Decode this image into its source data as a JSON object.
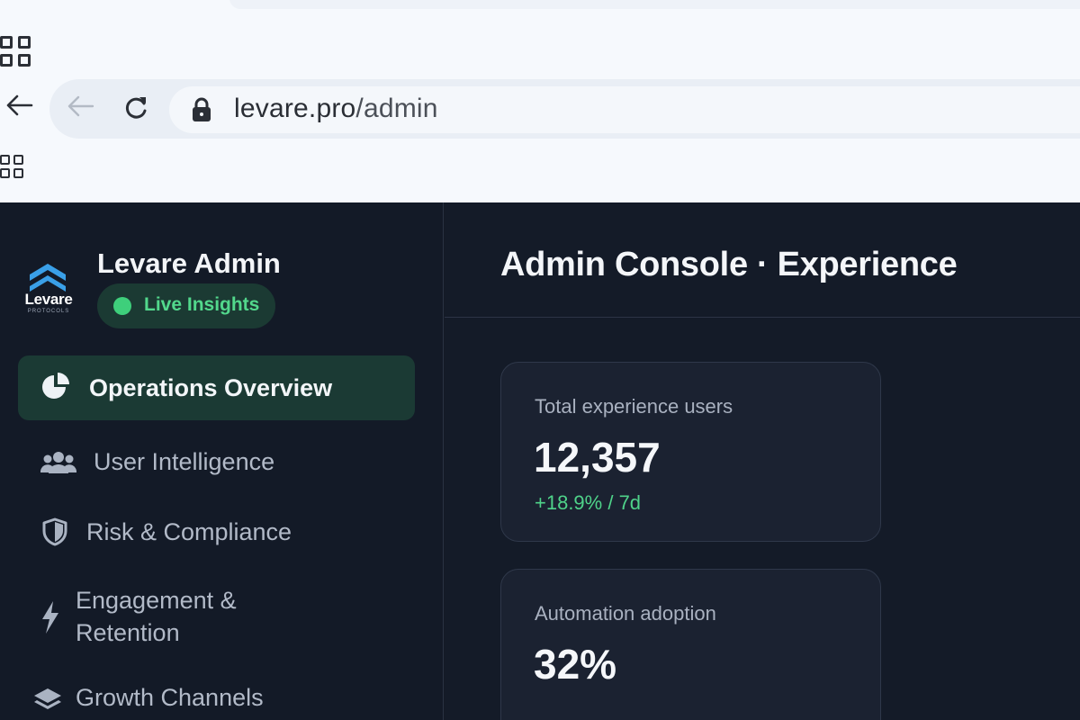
{
  "browser": {
    "url_host": "levare.pro",
    "url_path": "/admin"
  },
  "brand": {
    "logo_text": "Levare",
    "logo_subtext": "PROTOCOLS",
    "title": "Levare Admin",
    "status_badge": "Live Insights"
  },
  "nav": {
    "items": [
      {
        "label": "Operations Overview",
        "icon": "pie-chart-icon",
        "active": true
      },
      {
        "label": "User Intelligence",
        "icon": "users-icon",
        "active": false
      },
      {
        "label": "Risk & Compliance",
        "icon": "shield-icon",
        "active": false
      },
      {
        "label": "Engagement &",
        "label_line2": "Retention",
        "icon": "lightning-icon",
        "active": false
      },
      {
        "label": "Growth Channels",
        "icon": "layers-icon",
        "active": false
      }
    ]
  },
  "main": {
    "title": "Admin Console · Experience",
    "cards": [
      {
        "label": "Total experience users",
        "value": "12,357",
        "delta": "+18.9% / 7d"
      },
      {
        "label": "Automation adoption",
        "value": "32%"
      }
    ]
  },
  "colors": {
    "accent_green": "#3ecf7b",
    "sidebar_bg": "#131a27",
    "active_item_bg": "#1b3a34",
    "logo_blue": "#3aa0e8"
  }
}
